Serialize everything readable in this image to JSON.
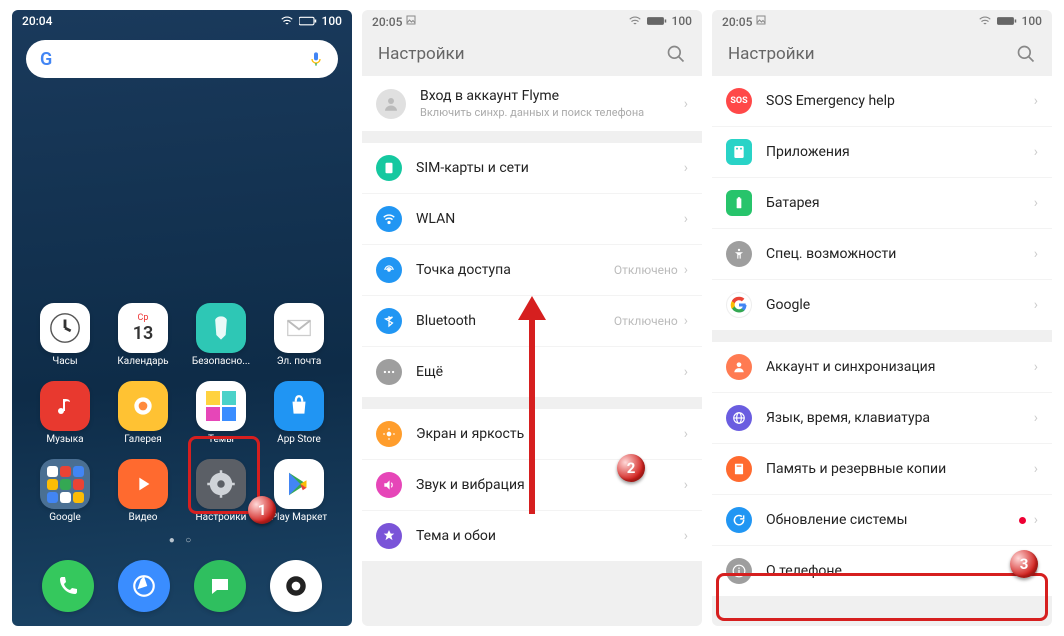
{
  "panel1": {
    "status": {
      "time": "20:04",
      "battery": "100"
    },
    "apps": [
      {
        "label": "Часы",
        "icon": "clock",
        "bg": "#ffffff"
      },
      {
        "label": "Календарь",
        "icon": "calendar",
        "bg": "#ffffff"
      },
      {
        "label": "Безопасно...",
        "icon": "umbrella",
        "bg": "#2ec7b5"
      },
      {
        "label": "Эл. почта",
        "icon": "mail",
        "bg": "#ffffff"
      },
      {
        "label": "Музыка",
        "icon": "music",
        "bg": "#e8392f"
      },
      {
        "label": "Галерея",
        "icon": "gallery",
        "bg": "#ffc233"
      },
      {
        "label": "Темы",
        "icon": "themes",
        "bg": "#ffffff"
      },
      {
        "label": "App Store",
        "icon": "bag",
        "bg": "#2095f3"
      },
      {
        "label": "Google",
        "icon": "folder",
        "bg": "#5d94c8"
      },
      {
        "label": "Видео",
        "icon": "play",
        "bg": "#ff6a2f"
      },
      {
        "label": "Настройки",
        "icon": "gear",
        "bg": "#5b5f66"
      },
      {
        "label": "Play Маркет",
        "icon": "playstore",
        "bg": "#ffffff"
      }
    ],
    "calendar": {
      "dow": "Ср",
      "day": "13"
    }
  },
  "panel2": {
    "status": {
      "time": "20:05",
      "battery": "100"
    },
    "title": "Настройки",
    "flyme": {
      "title": "Вход в аккаунт Flyme",
      "sub": "Включить синхр. данных и поиск телефона"
    },
    "rows": [
      {
        "icon": "sim",
        "bg": "#15c8a0",
        "label": "SIM-карты и сети"
      },
      {
        "icon": "wifi",
        "bg": "#2196f3",
        "label": "WLAN",
        "status": " "
      },
      {
        "icon": "hotspot",
        "bg": "#2196f3",
        "label": "Точка доступа",
        "status": "Отключено"
      },
      {
        "icon": "bt",
        "bg": "#2196f3",
        "label": "Bluetooth",
        "status": "Отключено"
      },
      {
        "icon": "more",
        "bg": "#9e9e9e",
        "label": "Ещё"
      }
    ],
    "rows2": [
      {
        "icon": "display",
        "bg": "#ff9d2c",
        "label": "Экран и яркость"
      },
      {
        "icon": "sound",
        "bg": "#e646b8",
        "label": "Звук и вибрация"
      },
      {
        "icon": "theme",
        "bg": "#7a54d8",
        "label": "Тема и обои"
      }
    ]
  },
  "panel3": {
    "status": {
      "time": "20:05",
      "battery": "100"
    },
    "title": "Настройки",
    "rows": [
      {
        "icon": "sos",
        "bg": "#ff4848",
        "label": "SOS Emergency help"
      },
      {
        "icon": "apps",
        "bg": "#29d3c7",
        "shape": "square",
        "label": "Приложения"
      },
      {
        "icon": "battery",
        "bg": "#27c46b",
        "shape": "square",
        "label": "Батарея"
      },
      {
        "icon": "access",
        "bg": "#9e9e9e",
        "label": "Спец. возможности"
      },
      {
        "icon": "google",
        "bg": "#ffffff",
        "label": "Google"
      }
    ],
    "rows2": [
      {
        "icon": "account",
        "bg": "#ff7b52",
        "label": "Аккаунт и синхронизация"
      },
      {
        "icon": "lang",
        "bg": "#6a5de0",
        "label": "Язык, время, клавиатура"
      },
      {
        "icon": "storage",
        "bg": "#ff6a2f",
        "label": "Память и резервные копии"
      },
      {
        "icon": "update",
        "bg": "#2196f3",
        "label": "Обновление системы",
        "dot": true
      },
      {
        "icon": "about",
        "bg": "#9e9e9e",
        "label": "О телефоне"
      }
    ]
  },
  "callouts": {
    "one": "1",
    "two": "2",
    "three": "3"
  }
}
